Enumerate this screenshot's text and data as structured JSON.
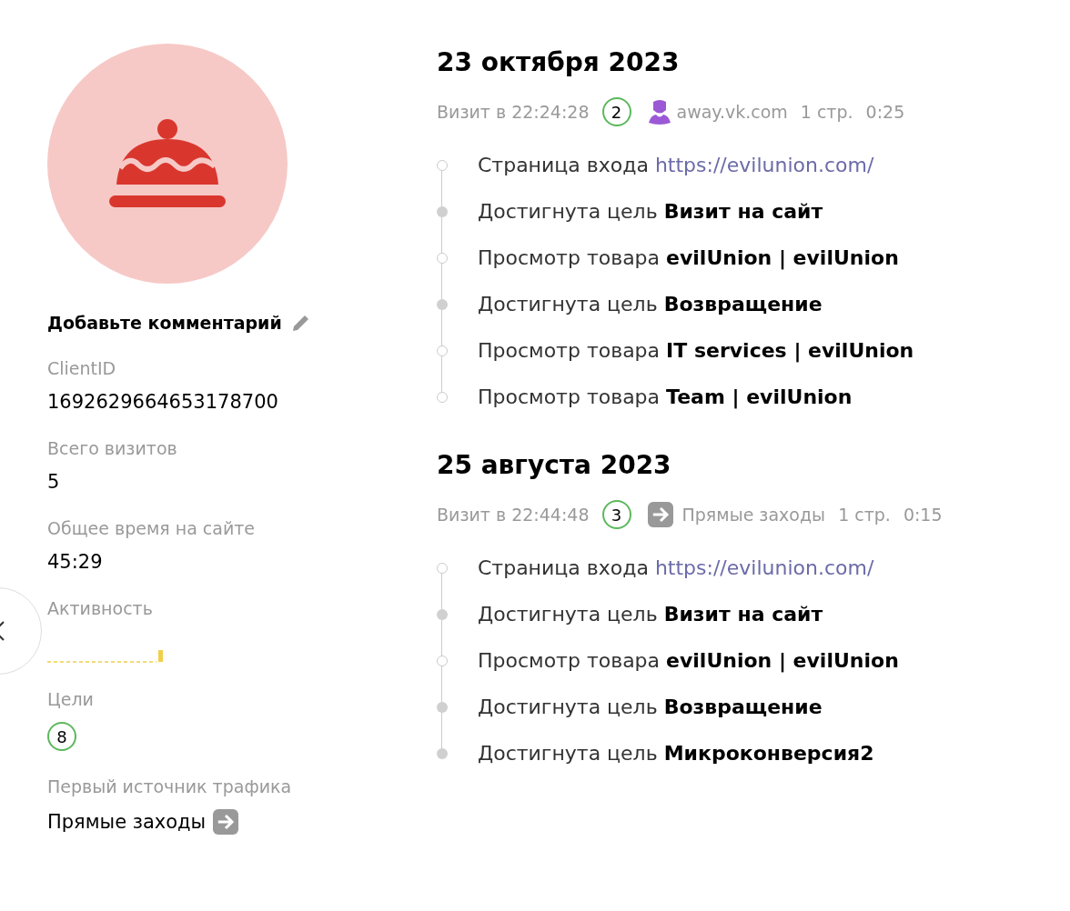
{
  "profile": {
    "comment": "Добавьте комментарий",
    "fields": [
      {
        "kind": "text",
        "label": "ClientID",
        "value": "1692629664653178700"
      },
      {
        "kind": "text",
        "label": "Всего визитов",
        "value": "5"
      },
      {
        "kind": "text",
        "label": "Общее время на сайте",
        "value": "45:29"
      },
      {
        "kind": "activity",
        "label": "Активность"
      },
      {
        "kind": "goals",
        "label": "Цели",
        "value": "8"
      },
      {
        "kind": "source",
        "label": "Первый источник трафика",
        "value": "Прямые заходы"
      }
    ]
  },
  "visits": [
    {
      "date": "23 октября 2023",
      "time": "Визит в 22:24:28",
      "number": "2",
      "source": {
        "kind": "referral",
        "label": "away.vk.com"
      },
      "pages": "1 стр.",
      "duration": "0:25",
      "events": [
        {
          "kind": "entry",
          "label": "Страница входа",
          "target": "https://evilunion.com/"
        },
        {
          "kind": "goal",
          "label": "Достигнута цель",
          "target": "Визит на сайт"
        },
        {
          "kind": "view",
          "label": "Просмотр товара",
          "target": "evilUnion | evilUnion"
        },
        {
          "kind": "goal",
          "label": "Достигнута цель",
          "target": "Возвращение"
        },
        {
          "kind": "view",
          "label": "Просмотр товара",
          "target": "IT services | evilUnion"
        },
        {
          "kind": "view",
          "label": "Просмотр товара",
          "target": "Team | evilUnion"
        }
      ]
    },
    {
      "date": "25 августа 2023",
      "time": "Визит в 22:44:48",
      "number": "3",
      "source": {
        "kind": "direct",
        "label": "Прямые заходы"
      },
      "pages": "1 стр.",
      "duration": "0:15",
      "events": [
        {
          "kind": "entry",
          "label": "Страница входа",
          "target": "https://evilunion.com/"
        },
        {
          "kind": "goal",
          "label": "Достигнута цель",
          "target": "Визит на сайт"
        },
        {
          "kind": "view",
          "label": "Просмотр товара",
          "target": "evilUnion | evilUnion"
        },
        {
          "kind": "goal",
          "label": "Достигнута цель",
          "target": "Возвращение"
        },
        {
          "kind": "goal",
          "label": "Достигнута цель",
          "target": "Микроконверсия2"
        }
      ]
    }
  ]
}
